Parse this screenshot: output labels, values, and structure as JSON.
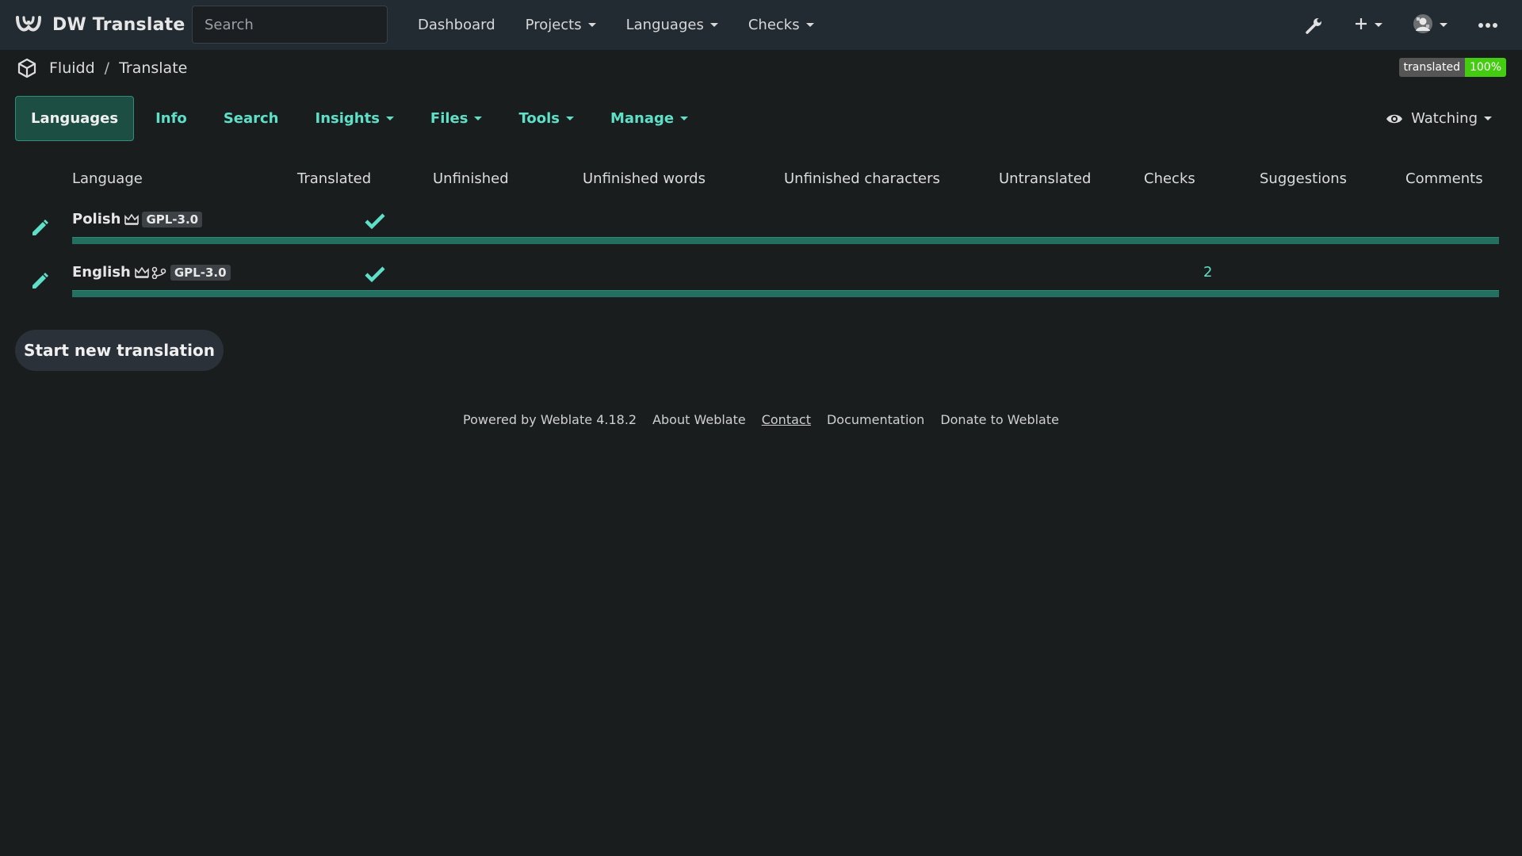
{
  "navbar": {
    "brand": "DW Translate",
    "search_placeholder": "Search",
    "links": [
      "Dashboard",
      "Projects",
      "Languages",
      "Checks"
    ]
  },
  "breadcrumb": {
    "project": "Fluidd",
    "separator": "/",
    "component": "Translate"
  },
  "status_badge": {
    "label": "translated",
    "value": "100%"
  },
  "tabs": [
    "Languages",
    "Info",
    "Search",
    "Insights",
    "Files",
    "Tools",
    "Manage"
  ],
  "watching_label": "Watching",
  "table": {
    "headers": [
      "Language",
      "Translated",
      "Unfinished",
      "Unfinished words",
      "Unfinished characters",
      "Untranslated",
      "Checks",
      "Suggestions",
      "Comments"
    ],
    "rows": [
      {
        "language": "Polish",
        "license": "GPL-3.0",
        "translated_fraction": 1.0,
        "checks": ""
      },
      {
        "language": "English",
        "license": "GPL-3.0",
        "translated_fraction": 1.0,
        "checks": "2"
      }
    ]
  },
  "start_button": "Start new translation",
  "footer": {
    "powered": "Powered by Weblate 4.18.2",
    "about": "About Weblate",
    "contact": "Contact",
    "docs": "Documentation",
    "donate": "Donate to Weblate"
  },
  "colors": {
    "accent": "#5ee0c8",
    "progress": "#247060",
    "badge_green": "#44cc11"
  }
}
